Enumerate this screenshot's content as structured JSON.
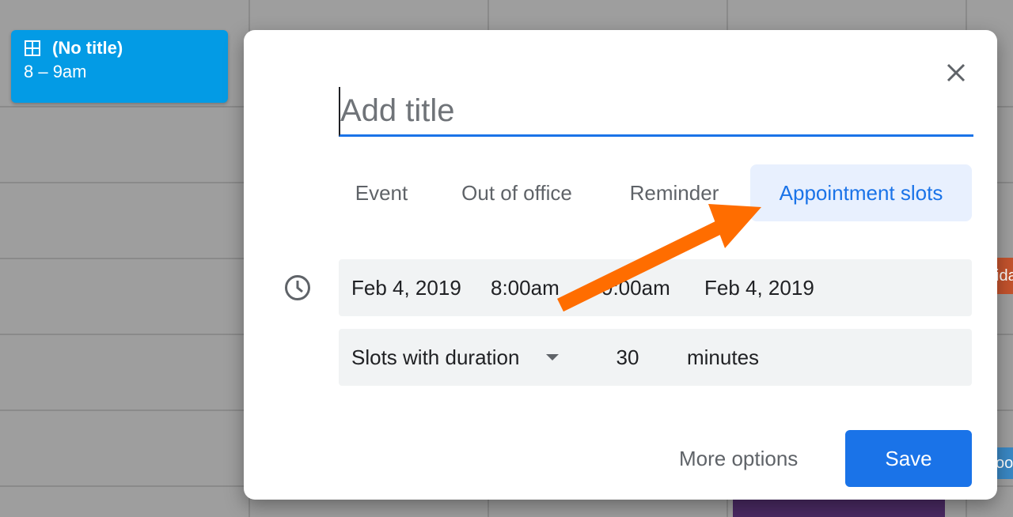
{
  "calendar": {
    "event_chip": {
      "title": "(No title)",
      "time": "8 – 9am",
      "icon": "grid-icon"
    },
    "side_badge_red_text": "ida",
    "side_badge_blue_text": "oo"
  },
  "dialog": {
    "close_icon": "close-icon",
    "title_placeholder": "Add title",
    "tabs": [
      {
        "label": "Event",
        "active": false
      },
      {
        "label": "Out of office",
        "active": false
      },
      {
        "label": "Reminder",
        "active": false
      },
      {
        "label": "Appointment slots",
        "active": true
      }
    ],
    "datetime": {
      "icon": "clock-icon",
      "start_date": "Feb 4, 2019",
      "start_time": "8:00am",
      "separator": "–",
      "end_time": "9:00am",
      "end_date": "Feb 4, 2019"
    },
    "slots": {
      "select_value": "Slots with duration",
      "duration": "30",
      "unit": "minutes"
    },
    "footer": {
      "more_options": "More options",
      "save": "Save"
    }
  },
  "colors": {
    "accent": "#1a73e8",
    "tab_active_bg": "#e8f0fe",
    "field_bg": "#f1f3f4",
    "event_chip": "#039be5",
    "annotation_arrow": "#ff6d00"
  }
}
